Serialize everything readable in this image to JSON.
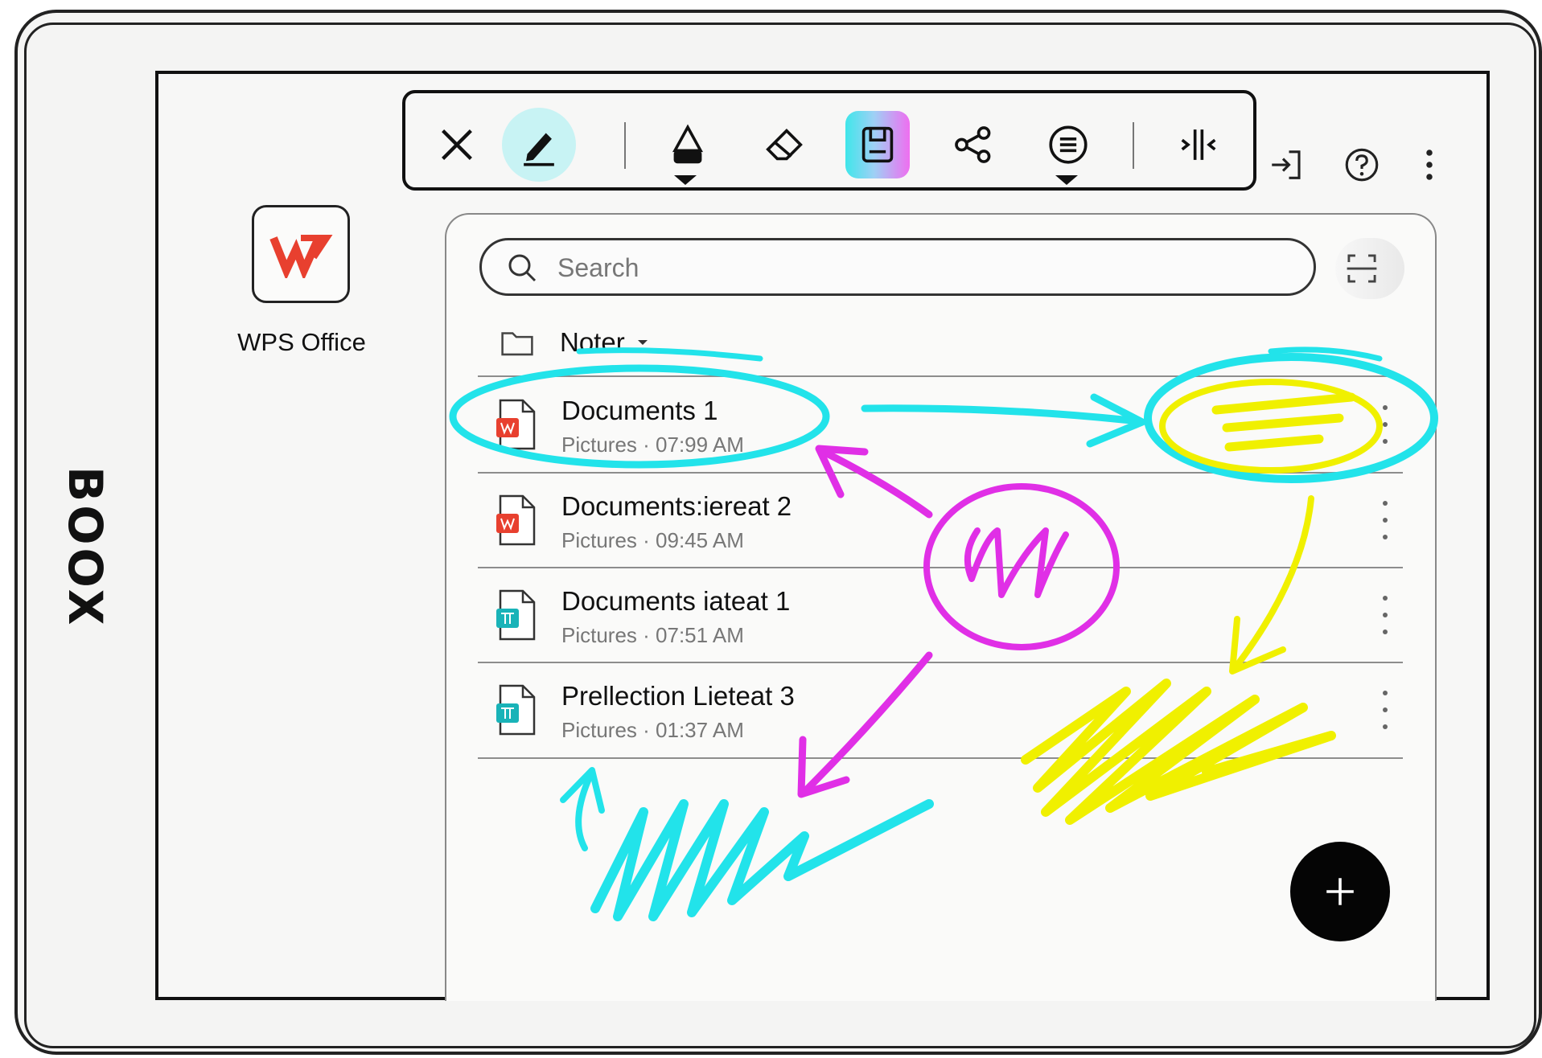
{
  "device": {
    "brand": "BOOX"
  },
  "toolbar": {
    "tools": [
      {
        "name": "close",
        "icon": "close-icon"
      },
      {
        "name": "pen",
        "icon": "pen-icon",
        "active": true
      },
      {
        "name": "highlighter",
        "icon": "highlighter-icon"
      },
      {
        "name": "eraser",
        "icon": "eraser-icon"
      },
      {
        "name": "save",
        "icon": "save-icon"
      },
      {
        "name": "share",
        "icon": "share-icon"
      },
      {
        "name": "menu",
        "icon": "list-menu-icon"
      },
      {
        "name": "split",
        "icon": "split-view-icon"
      }
    ],
    "right_icons": [
      "exit-icon",
      "help-icon",
      "more-vert-icon"
    ]
  },
  "app": {
    "label": "WPS Office",
    "icon": "wps-office-icon"
  },
  "search": {
    "placeholder": "Search"
  },
  "folder": {
    "name": "Noter"
  },
  "files": [
    {
      "name": "Documents 1",
      "meta": "Pictures · 07:99 AM",
      "type": "red"
    },
    {
      "name": "Documents:iereat 2",
      "meta": "Pictures · 09:45 AM",
      "type": "red"
    },
    {
      "name": "Documents iateat 1",
      "meta": "Pictures · 07:51 AM",
      "type": "teal"
    },
    {
      "name": "Prellection Lieteat 3",
      "meta": "Pictures · 01:37 AM",
      "type": "teal"
    }
  ],
  "colors": {
    "accent_cyan": "#22e3ea",
    "accent_magenta": "#e02fe6",
    "accent_yellow": "#f0f000",
    "wps_red": "#e8402f",
    "file_teal": "#19b3b8"
  }
}
